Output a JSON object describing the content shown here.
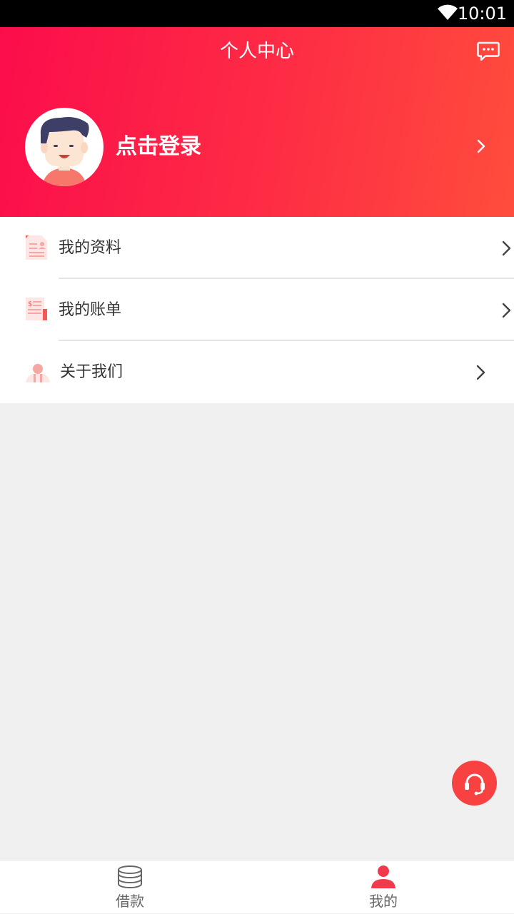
{
  "status_bar": {
    "time": "10:01"
  },
  "header": {
    "title": "个人中心",
    "login_label": "点击登录"
  },
  "menu": [
    {
      "label": "我的资料",
      "icon": "profile-doc-icon"
    },
    {
      "label": "我的账单",
      "icon": "bill-icon"
    },
    {
      "label": "关于我们",
      "icon": "about-us-icon"
    }
  ],
  "tabbar": {
    "tabs": [
      {
        "label": "借款",
        "icon": "coins-stack-icon",
        "active": false
      },
      {
        "label": "我的",
        "icon": "person-icon",
        "active": true
      }
    ]
  },
  "colors": {
    "brand": "#fb0d4b",
    "accent": "#ff4d3c",
    "tab_active": "#f03a4b",
    "tab_inactive": "#666666"
  }
}
